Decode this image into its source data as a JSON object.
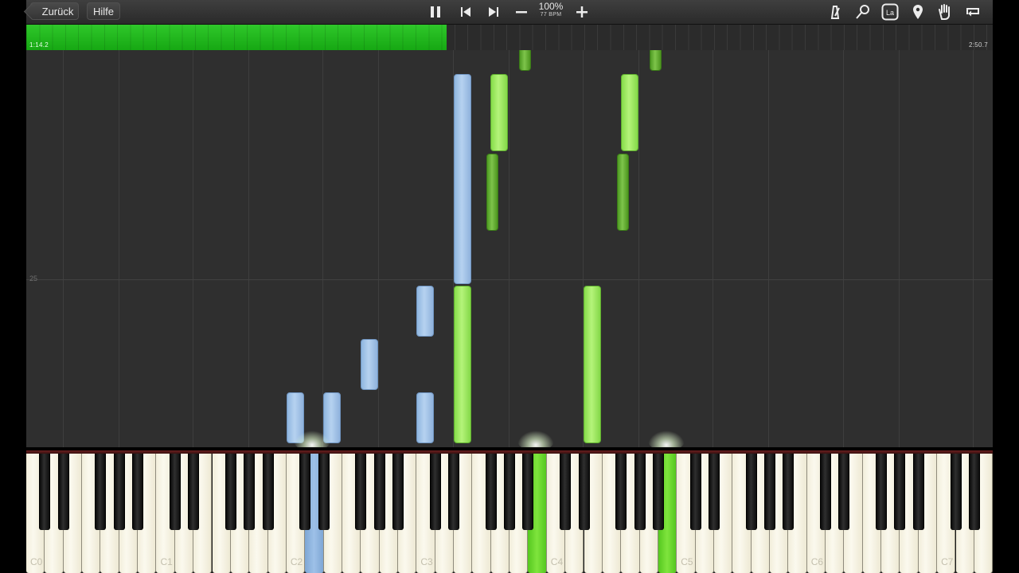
{
  "toolbar": {
    "back_label": "Zurück",
    "help_label": "Hilfe",
    "zoom_percent": "100%",
    "bpm_label": "77 BPM",
    "controls": [
      "pause-icon",
      "skip-back-icon",
      "skip-forward-icon",
      "minus-icon",
      "plus-icon"
    ],
    "tools": [
      "metronome-icon",
      "magnifier-icon",
      "note-label-icon",
      "location-pin-icon",
      "hand-icon",
      "loop-icon"
    ],
    "note_label_text": "La"
  },
  "progress": {
    "elapsed": "1:14.2",
    "total": "2:50.7",
    "fraction": 0.435,
    "color": "#2fc72a"
  },
  "roll": {
    "measure_number": "25"
  },
  "keyboard": {
    "octave_labels": [
      "C0",
      "C1",
      "C2",
      "C3",
      "C4",
      "C5",
      "C6",
      "C7"
    ]
  },
  "colors": {
    "left_hand": "#9ec1e8",
    "right_hand": "#a8ee6a",
    "right_hand_dark": "#5fa82e"
  }
}
